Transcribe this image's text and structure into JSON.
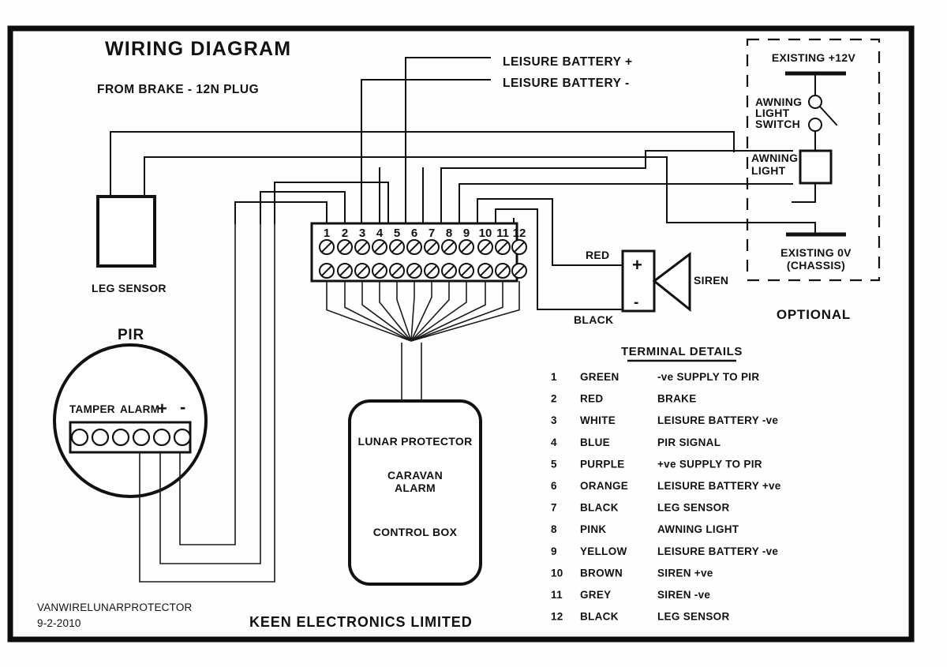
{
  "document": {
    "title": "WIRING DIAGRAM",
    "company": "KEEN ELECTRONICS LIMITED",
    "drawing_ref": "VANWIRELUNARPROTECTOR",
    "drawing_date": "9-2-2010"
  },
  "labels": {
    "from_brake": "FROM BRAKE - 12N PLUG",
    "leisure_battery_pos": "LEISURE BATTERY +",
    "leisure_battery_neg": "LEISURE BATTERY -",
    "leg_sensor": "LEG SENSOR",
    "pir": "PIR",
    "siren": "SIREN",
    "siren_red": "RED",
    "siren_black": "BLACK",
    "optional": "OPTIONAL",
    "existing_12v": "EXISTING +12V",
    "existing_0v_line1": "EXISTING 0V",
    "existing_0v_line2": "(CHASSIS)",
    "awning_light_switch_line1": "AWNING",
    "awning_light_switch_line2": "LIGHT",
    "awning_light_switch_line3": "SWITCH",
    "awning_light_line1": "AWNING",
    "awning_light_line2": "LIGHT"
  },
  "control_box": {
    "line1": "LUNAR PROTECTOR",
    "line2": "CARAVAN",
    "line3": "ALARM",
    "line4": "CONTROL BOX"
  },
  "pir_terminals": {
    "label_tamper": "TAMPER",
    "label_alarm": "ALARM",
    "label_plus": "+",
    "label_minus": "-",
    "hole_count": 6
  },
  "siren_terminals": {
    "plus": "+",
    "minus": "-"
  },
  "terminal_block": {
    "numbers": [
      "1",
      "2",
      "3",
      "4",
      "5",
      "6",
      "7",
      "8",
      "9",
      "10",
      "11",
      "12"
    ]
  },
  "terminal_details": {
    "heading": "TERMINAL DETAILS",
    "rows": [
      {
        "num": "1",
        "colour": "GREEN",
        "function": "-ve SUPPLY TO PIR"
      },
      {
        "num": "2",
        "colour": "RED",
        "function": "BRAKE"
      },
      {
        "num": "3",
        "colour": "WHITE",
        "function": "LEISURE BATTERY -ve"
      },
      {
        "num": "4",
        "colour": "BLUE",
        "function": "PIR SIGNAL"
      },
      {
        "num": "5",
        "colour": "PURPLE",
        "function": "+ve SUPPLY TO PIR"
      },
      {
        "num": "6",
        "colour": "ORANGE",
        "function": "LEISURE BATTERY +ve"
      },
      {
        "num": "7",
        "colour": "BLACK",
        "function": "LEG SENSOR"
      },
      {
        "num": "8",
        "colour": "PINK",
        "function": "AWNING LIGHT"
      },
      {
        "num": "9",
        "colour": "YELLOW",
        "function": "LEISURE BATTERY -ve"
      },
      {
        "num": "10",
        "colour": "BROWN",
        "function": "SIREN +ve"
      },
      {
        "num": "11",
        "colour": "GREY",
        "function": "SIREN -ve"
      },
      {
        "num": "12",
        "colour": "BLACK",
        "function": "LEG SENSOR"
      }
    ]
  },
  "colors": {
    "ink": "#111111",
    "paper": "#fefefe"
  }
}
